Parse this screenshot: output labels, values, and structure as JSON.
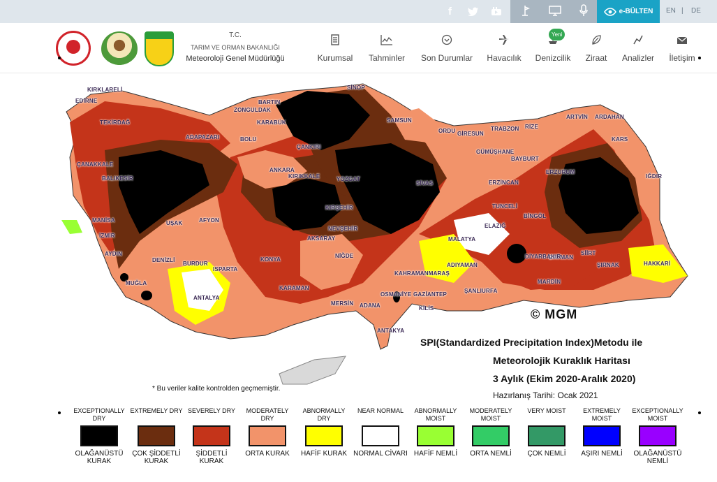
{
  "topbar": {
    "social_icons": [
      "facebook-icon",
      "twitter-icon",
      "youtube-icon"
    ],
    "tools": [
      "weather-station-icon",
      "monitor-icon",
      "microphone-icon"
    ],
    "ebulten_label": "e-BÜLTEN",
    "lang_en": "EN",
    "lang_sep": "|",
    "lang_de": "DE"
  },
  "header": {
    "org_line1": "T.C.",
    "org_line2": "TARIM VE ORMAN BAKANLIĞI",
    "org_line3": "Meteoroloji Genel Müdürlüğü",
    "nav": [
      {
        "label": "Kurumsal",
        "icon": "document-icon"
      },
      {
        "label": "Tahminler",
        "icon": "chart-icon"
      },
      {
        "label": "Son Durumlar",
        "icon": "chevron-circle-icon"
      },
      {
        "label": "Havacılık",
        "icon": "airplane-icon"
      },
      {
        "label": "Denizcilik",
        "icon": "ship-icon"
      },
      {
        "label": "Ziraat",
        "icon": "leaf-icon"
      },
      {
        "label": "Analizler",
        "icon": "analysis-icon"
      },
      {
        "label": "İletişim",
        "icon": "envelope-icon"
      }
    ],
    "new_badge": "Yeni"
  },
  "map": {
    "copyright": "© MGM",
    "title_line1": "SPI(Standardized Precipitation Index)Metodu ile",
    "title_line2": "Meteorolojik Kuraklık Haritası",
    "title_line3": "3 Aylık (Ekim 2020-Aralık 2020)",
    "prepared": "Hazırlanış Tarihi: Ocak 2021",
    "note": "* Bu veriler kalite kontrolden geçmemiştir.",
    "cities": [
      "KIRKLARELİ",
      "EDİRNE",
      "TEKİRDAĞ",
      "BARTIN",
      "ZONGULDAK",
      "KARABÜK",
      "SİNOP",
      "SAMSUN",
      "ORDU",
      "GİRESUN",
      "TRABZON",
      "RİZE",
      "ARTVİN",
      "ARDAHAN",
      "KARS",
      "IĞDIR",
      "ÇANAKKALE",
      "BALIKESİR",
      "ADAPAZARI",
      "BOLU",
      "ÇANKIRI",
      "ANKARA",
      "KIRIKKALE",
      "YOZGAT",
      "GÜMÜŞHANE",
      "BAYBURT",
      "ERZURUM",
      "ERZİNCAN",
      "KIRŞEHİR",
      "NEVŞEHİR",
      "SİVAS",
      "TUNCELİ",
      "BİNGÖL",
      "ELAZIĞ",
      "MANİSA",
      "İZMİR",
      "AFYON",
      "AKSARAY",
      "NİĞDE",
      "MALATYA",
      "AYDIN",
      "DENİZLİ",
      "BURDUR",
      "ISPARTA",
      "KONYA",
      "KAHRAMANMARAŞ",
      "ADIYAMAN",
      "BATMAN",
      "SİİRT",
      "ŞIRNAK",
      "HAKKARİ",
      "MARDİN",
      "ŞANLIURFA",
      "KARAMAN",
      "MERSİN",
      "ADANA",
      "OSMANİYE",
      "GAZİANTEP",
      "KİLİS",
      "ANTALYA",
      "ANTAKYA",
      "MUĞLA",
      "DİYARBAKIR",
      "UŞAK"
    ]
  },
  "legend": [
    {
      "top": "EXCEPTIONALLY DRY",
      "bottom": "OLAĞANÜSTÜ KURAK",
      "color": "#000000"
    },
    {
      "top": "EXTREMELY DRY",
      "bottom": "ÇOK ŞİDDETLİ KURAK",
      "color": "#6b2d0f"
    },
    {
      "top": "SEVERELY DRY",
      "bottom": "ŞİDDETLİ KURAK",
      "color": "#c4341a"
    },
    {
      "top": "MODERATELY DRY",
      "bottom": "ORTA KURAK",
      "color": "#f2936a"
    },
    {
      "top": "ABNORMALLY DRY",
      "bottom": "HAFİF KURAK",
      "color": "#ffff00"
    },
    {
      "top": "NEAR NORMAL",
      "bottom": "NORMAL CİVARI",
      "color": "#ffffff"
    },
    {
      "top": "ABNORMALLY MOIST",
      "bottom": "HAFİF NEMLİ",
      "color": "#99ff33"
    },
    {
      "top": "MODERATELY MOIST",
      "bottom": "ORTA NEMLİ",
      "color": "#33cc66"
    },
    {
      "top": "VERY MOIST",
      "bottom": "ÇOK NEMLİ",
      "color": "#339966"
    },
    {
      "top": "EXTREMELY MOIST",
      "bottom": "AŞIRI NEMLİ",
      "color": "#0000ff"
    },
    {
      "top": "EXCEPTIONALLY MOIST",
      "bottom": "OLAĞANÜSTÜ NEMLİ",
      "color": "#9900ff"
    }
  ]
}
